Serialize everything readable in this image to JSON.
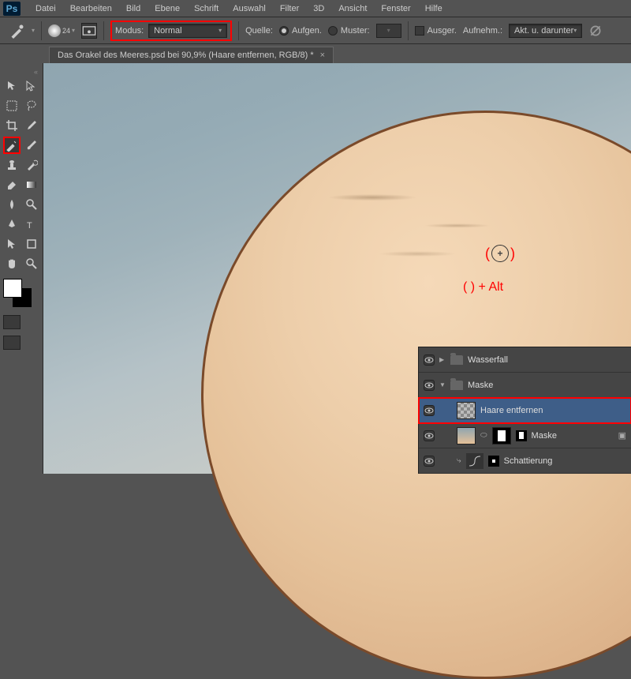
{
  "menu": {
    "items": [
      "Datei",
      "Bearbeiten",
      "Bild",
      "Ebene",
      "Schrift",
      "Auswahl",
      "Filter",
      "3D",
      "Ansicht",
      "Fenster",
      "Hilfe"
    ]
  },
  "options": {
    "brush_size": "24",
    "mode_label": "Modus:",
    "mode_value": "Normal",
    "source_label": "Quelle:",
    "radio_sampled": "Aufgen.",
    "radio_pattern": "Muster:",
    "aligned": "Ausger.",
    "sample_label": "Aufnehm.:",
    "sample_value": "Akt. u. darunter"
  },
  "tab": {
    "title": "Das Orakel des Meeres.psd bei 90,9% (Haare entfernen, RGB/8) *"
  },
  "annotation": {
    "alt_text": "( ) + Alt"
  },
  "layers": {
    "items": [
      {
        "type": "folder",
        "name": "Wasserfall",
        "open": false
      },
      {
        "type": "folder",
        "name": "Maske",
        "open": true
      },
      {
        "type": "layer",
        "name": "Haare entfernen",
        "selected": true,
        "hl": true
      },
      {
        "type": "masked",
        "name": "Maske"
      },
      {
        "type": "schatt",
        "name": "Schattierung"
      }
    ]
  }
}
